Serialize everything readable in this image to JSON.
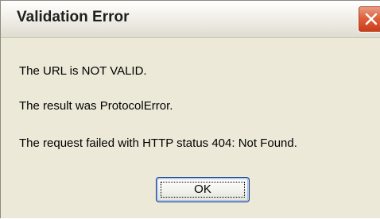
{
  "window": {
    "title": "Validation Error"
  },
  "message": {
    "line1": "The URL is NOT VALID.",
    "line2": "The result was ProtocolError.",
    "line3": "The request failed with HTTP status 404: Not Found."
  },
  "buttons": {
    "ok_label": "OK",
    "close_icon": "close-icon"
  },
  "colors": {
    "dialog_background": "#ece9d8",
    "close_button": "#e0613c",
    "button_border": "#003c74"
  }
}
